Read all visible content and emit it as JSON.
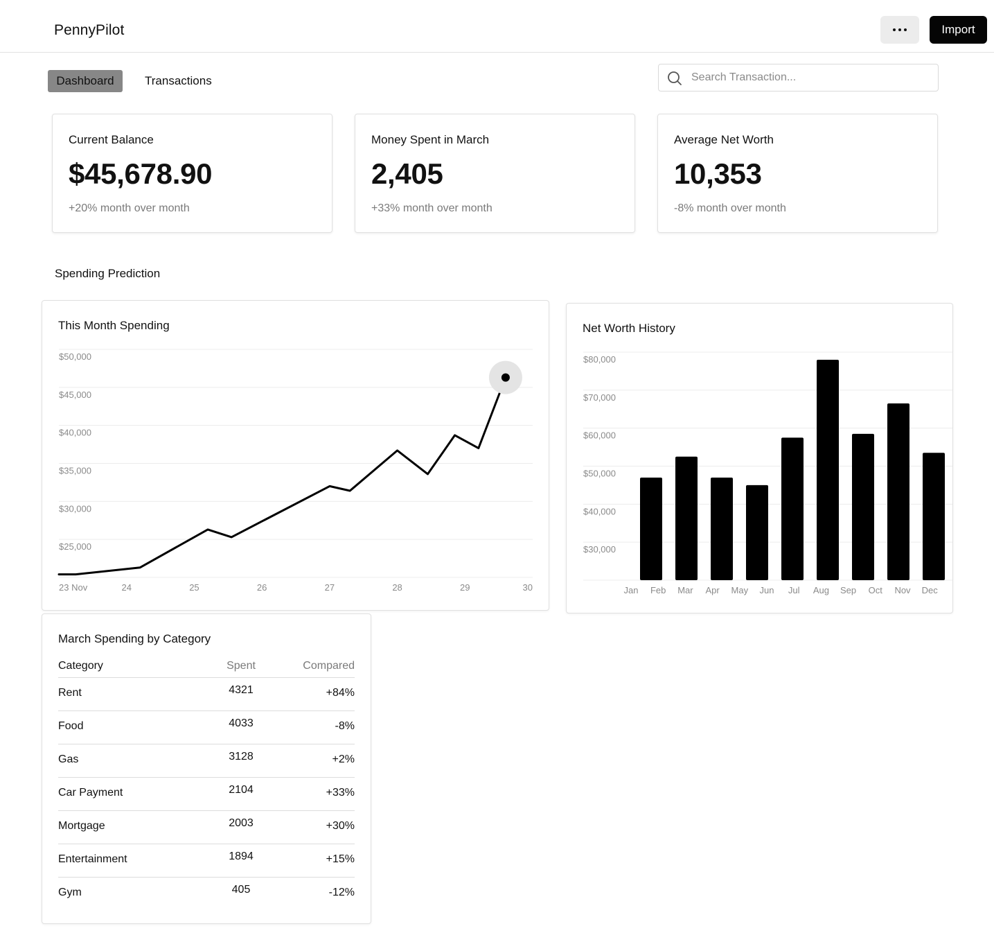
{
  "app": {
    "name": "PennyPilot"
  },
  "header": {
    "more_icon": "ellipsis-icon",
    "import_label": "Import"
  },
  "nav": {
    "tabs": [
      {
        "label": "Dashboard",
        "active": true
      },
      {
        "label": "Transactions",
        "active": false
      }
    ]
  },
  "search": {
    "placeholder": "Search Transaction...",
    "value": "",
    "icon": "search-icon"
  },
  "stats": [
    {
      "label": "Current Balance",
      "value": "$45,678.90",
      "change": "+20% month over month"
    },
    {
      "label": "Money Spent in March",
      "value": "2,405",
      "change": "+33% month over month"
    },
    {
      "label": "Average Net Worth",
      "value": "10,353",
      "change": "-8% month over month"
    }
  ],
  "section": {
    "title": "Spending Prediction"
  },
  "spending_chart": {
    "title": "This Month Spending"
  },
  "networth_chart": {
    "title": "Net Worth History"
  },
  "category_table": {
    "title": "March Spending by Category",
    "headers": {
      "category": "Category",
      "spent": "Spent",
      "compared": "Compared"
    },
    "rows": [
      {
        "category": "Rent",
        "spent": "4321",
        "compared": "+84%"
      },
      {
        "category": "Food",
        "spent": "4033",
        "compared": "-8%"
      },
      {
        "category": "Gas",
        "spent": "3128",
        "compared": "+2%"
      },
      {
        "category": "Car Payment",
        "spent": "2104",
        "compared": "+33%"
      },
      {
        "category": "Mortgage",
        "spent": "2003",
        "compared": "+30%"
      },
      {
        "category": "Entertainment",
        "spent": "1894",
        "compared": "+15%"
      },
      {
        "category": "Gym",
        "spent": "405",
        "compared": "-12%"
      }
    ]
  },
  "chart_data": [
    {
      "type": "line",
      "title": "This Month Spending",
      "x_tick_labels": [
        "23 Nov",
        "24",
        "25",
        "26",
        "27",
        "28",
        "29",
        "30"
      ],
      "y_tick_labels": [
        "$50,000",
        "$45,000",
        "$40,000",
        "$35,000",
        "$30,000",
        "$25,000"
      ],
      "ylim": [
        20000,
        50000
      ],
      "x": [
        23.0,
        23.25,
        24.2,
        25.2,
        25.55,
        27.0,
        27.3,
        28.0,
        28.45,
        28.85,
        29.2,
        29.6
      ],
      "values": [
        20400,
        20400,
        21300,
        26300,
        25300,
        32000,
        31400,
        36700,
        33600,
        38700,
        37000,
        46300
      ],
      "highlight_last_point": true,
      "grid": true,
      "colors": {
        "line": "#000000",
        "highlight": "#e4e4e4"
      }
    },
    {
      "type": "bar",
      "title": "Net Worth History",
      "categories": [
        "Jan",
        "Feb",
        "Mar",
        "Apr",
        "May",
        "Jun",
        "Jul",
        "Aug",
        "Sep",
        "Oct",
        "Nov",
        "Dec"
      ],
      "values": [
        null,
        47000,
        52500,
        47000,
        45000,
        57500,
        78000,
        58500,
        66500,
        53500,
        null,
        null
      ],
      "y_tick_labels": [
        "$80,000",
        "$70,000",
        "$60,000",
        "$50,000",
        "$40,000",
        "$30,000"
      ],
      "ylim": [
        20000,
        80000
      ],
      "grid": true,
      "colors": {
        "bar": "#000000"
      }
    }
  ]
}
